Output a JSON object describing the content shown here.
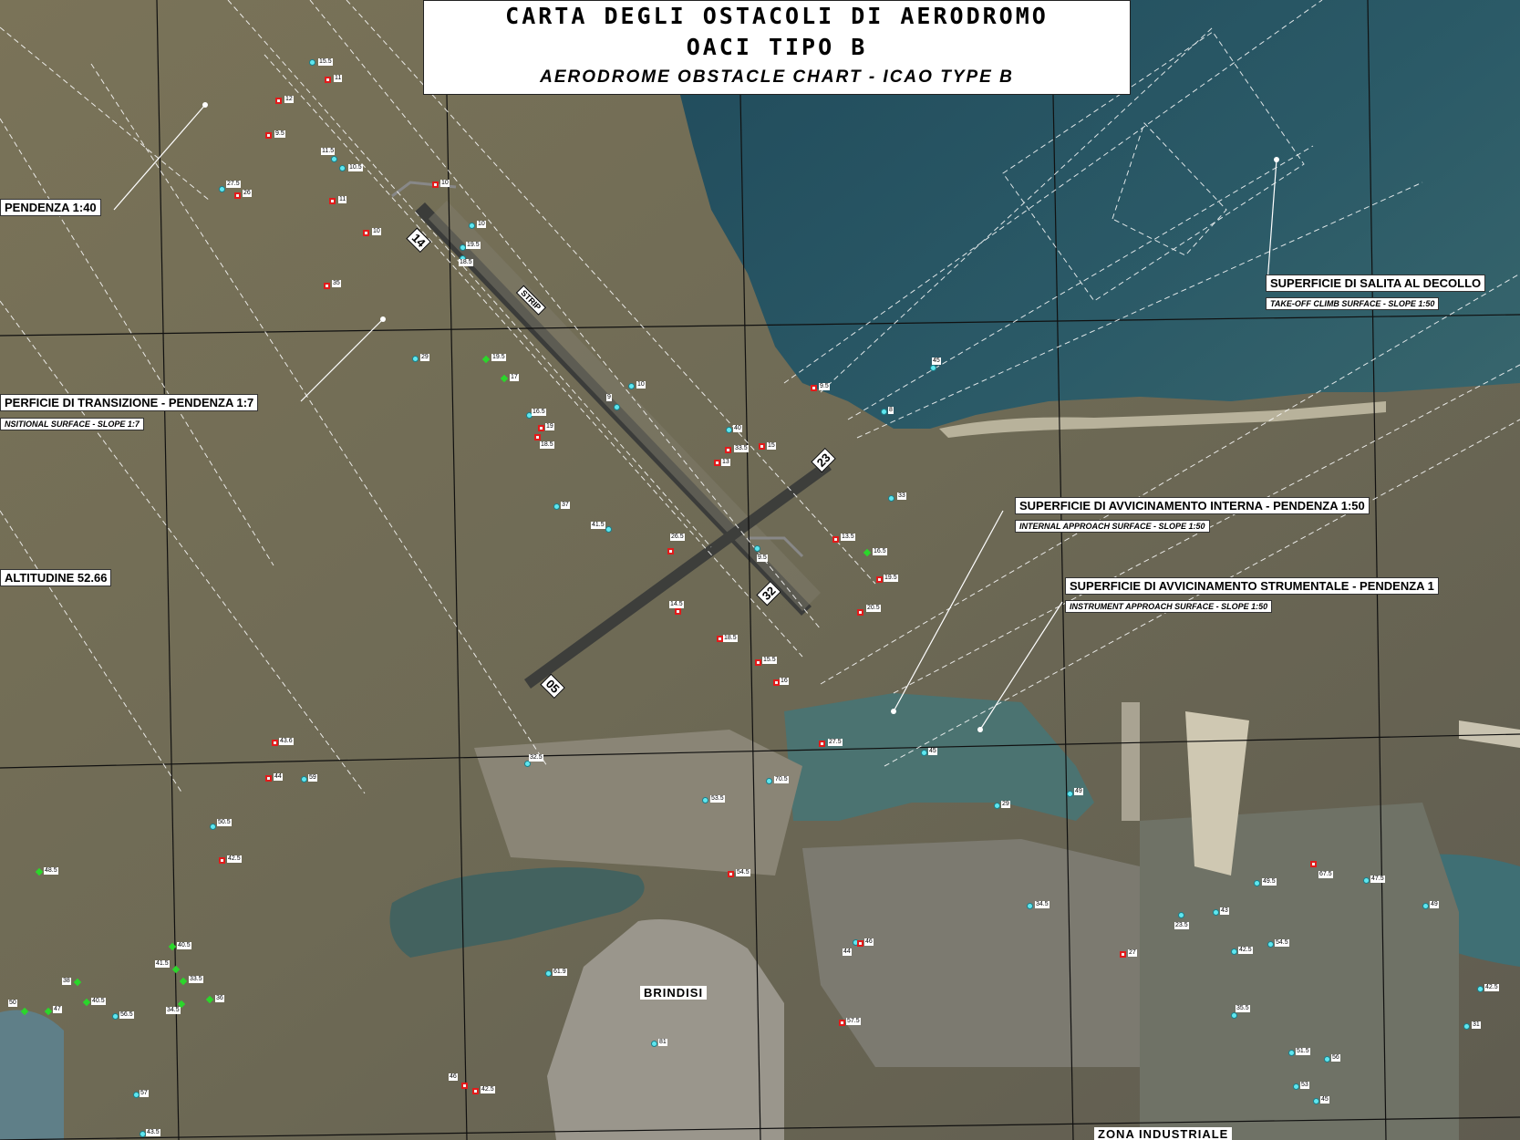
{
  "title": {
    "line1": "CARTA DEGLI OSTACOLI DI AERODROMO",
    "line2": "OACI TIPO B",
    "line3": "AERODROME OBSTACLE CHART - ICAO TYPE B"
  },
  "surfaces": {
    "pendenza_40": "PENDENZA 1:40",
    "transizione": "PERFICIE DI TRANSIZIONE - PENDENZA 1:7",
    "transizione_en": "NSITIONAL SURFACE - SLOPE 1:7",
    "altitudine": "ALTITUDINE 52.66",
    "salita": "SUPERFICIE DI SALITA AL DECOLLO",
    "salita_en": "TAKE-OFF CLIMB SURFACE - SLOPE 1:50",
    "interna": "SUPERFICIE DI AVVICINAMENTO INTERNA - PENDENZA 1:50",
    "interna_en": "INTERNAL APPROACH SURFACE - SLOPE 1:50",
    "strumentale": "SUPERFICIE DI AVVICINAMENTO STRUMENTALE - PENDENZA 1",
    "strumentale_en": "INSTRUMENT APPROACH SURFACE - SLOPE 1:50"
  },
  "runways": {
    "r14": "14",
    "r32": "32",
    "r23": "23",
    "r05": "05",
    "strip": "STRIP"
  },
  "places": {
    "brindisi": "BRINDISI",
    "zona": "ZONA INDUSTRIALE"
  },
  "colors": {
    "obstacle_cyan": "#5fe6ef",
    "obstacle_red": "#e21b1b",
    "obstacle_green": "#2bd62b"
  },
  "obstacles": {
    "o1": "15.5",
    "o2": "11",
    "o3": "12",
    "o4": "9.5",
    "o5": "11.5",
    "o6": "10.5",
    "o7": "27.5",
    "o8": "26",
    "o9": "10",
    "o10": "11",
    "o11": "10",
    "o12": "10",
    "o13": "19.5",
    "o14": "18.5",
    "o15": "35",
    "o16": "29",
    "o17": "19.5",
    "o18": "17",
    "o19": "16.5",
    "o20": "19",
    "o21": "18.5",
    "o22": "9",
    "o23": "10",
    "o24": "9.5",
    "o25": "40",
    "o26": "33.5",
    "o27": "15",
    "o28": "13",
    "o29": "45",
    "o30": "8",
    "o31": "33",
    "o32": "37",
    "o33": "41.5",
    "o34": "26.5",
    "o35": "13.5",
    "o36": "16.5",
    "o37": "19.5",
    "o38": "9.5",
    "o39": "20.5",
    "o40": "14.5",
    "o41": "18.5",
    "o42": "15.5",
    "o43": "16",
    "o44": "27.5",
    "o45": "45",
    "o46": "43.6",
    "o47": "44",
    "o48": "59",
    "o49": "32.5",
    "o50": "70.5",
    "o51": "53.5",
    "o52": "54.5",
    "o53": "48.5",
    "o54": "42.5",
    "o55": "44",
    "o56": "49",
    "o57": "34.5",
    "o58": "29",
    "o59": "27",
    "o60": "23.5",
    "o61": "43",
    "o62": "42.5",
    "o63": "54.5",
    "o64": "49.5",
    "o65": "67.5",
    "o66": "47.5",
    "o67": "49",
    "o68": "51.5",
    "o69": "56",
    "o70": "53",
    "o71": "45",
    "o72": "42.5",
    "o73": "31",
    "o74": "61.9",
    "o75": "81",
    "o76": "46",
    "o77": "42.5",
    "o78": "57",
    "o79": "43.5",
    "o80": "56.5",
    "o81": "50",
    "o82": "47",
    "o83": "40.5",
    "o84": "36",
    "o85": "41.5",
    "o86": "33.5",
    "o87": "34.5",
    "o88": "40.5",
    "o89": "38",
    "o90": "57.5",
    "o91": "46",
    "o92": "35.5",
    "o93": "50.5"
  }
}
